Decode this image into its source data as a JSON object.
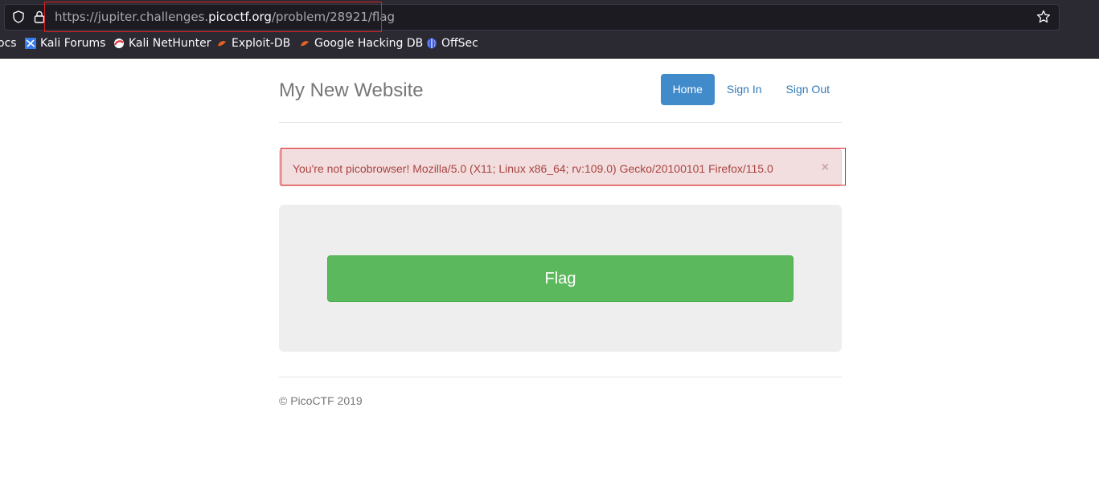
{
  "browser": {
    "url_prefix": "https://jupiter.challenges.",
    "url_domain": "picoctf.org",
    "url_path": "/problem/28921/flag",
    "bookmarks": [
      {
        "label": "ocs",
        "icon": "none"
      },
      {
        "label": "Kali Forums",
        "icon": "kali-forums-icon"
      },
      {
        "label": "Kali NetHunter",
        "icon": "kali-nethunter-icon"
      },
      {
        "label": "Exploit-DB",
        "icon": "exploit-db-icon"
      },
      {
        "label": "Google Hacking DB",
        "icon": "ghdb-icon"
      },
      {
        "label": "OffSec",
        "icon": "offsec-icon"
      }
    ]
  },
  "site": {
    "brand": "My New Website",
    "nav": [
      {
        "label": "Home",
        "active": true
      },
      {
        "label": "Sign In",
        "active": false
      },
      {
        "label": "Sign Out",
        "active": false
      }
    ]
  },
  "alert": {
    "message": "You're not picobrowser! Mozilla/5.0 (X11; Linux x86_64; rv:109.0) Gecko/20100101 Firefox/115.0",
    "close": "×"
  },
  "main": {
    "flag_button": "Flag"
  },
  "footer": {
    "text": "© PicoCTF 2019"
  },
  "colors": {
    "primary": "#428bca",
    "success": "#5cb85c",
    "danger_bg": "#f2dede",
    "danger_text": "#a94442",
    "annotation_red": "#e02020"
  }
}
